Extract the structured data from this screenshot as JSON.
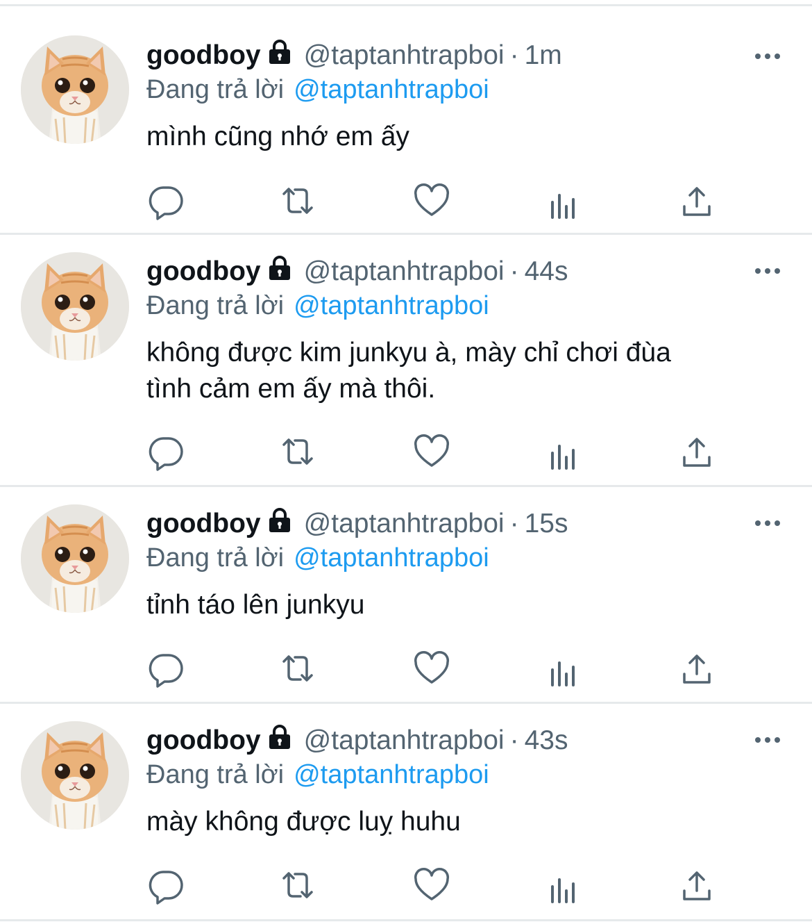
{
  "colors": {
    "text_primary": "#0f1419",
    "text_secondary": "#536471",
    "mention": "#1d9bf0",
    "divider": "#e6e9eb"
  },
  "icons": {
    "reply": "reply-icon",
    "retweet": "retweet-icon",
    "like": "heart-icon",
    "analytics": "analytics-icon",
    "share": "share-icon",
    "more": "more-icon",
    "protected": "lock-icon"
  },
  "tweets": [
    {
      "name": "goodboy",
      "handle": "@taptanhtrapboi",
      "separator": "·",
      "time": "1m",
      "reply_prefix": "Đang trả lời",
      "reply_to": "@taptanhtrapboi",
      "text": "mình cũng nhớ em ấy"
    },
    {
      "name": "goodboy",
      "handle": "@taptanhtrapboi",
      "separator": "·",
      "time": "44s",
      "reply_prefix": "Đang trả lời",
      "reply_to": "@taptanhtrapboi",
      "text": "không được kim junkyu à, mày chỉ chơi đùa\ntình cảm em ấy mà thôi."
    },
    {
      "name": "goodboy",
      "handle": "@taptanhtrapboi",
      "separator": "·",
      "time": "15s",
      "reply_prefix": "Đang trả lời",
      "reply_to": "@taptanhtrapboi",
      "text": "tỉnh táo lên junkyu"
    },
    {
      "name": "goodboy",
      "handle": "@taptanhtrapboi",
      "separator": "·",
      "time": "43s",
      "reply_prefix": "Đang trả lời",
      "reply_to": "@taptanhtrapboi",
      "text": "mày không được luỵ huhu"
    }
  ]
}
